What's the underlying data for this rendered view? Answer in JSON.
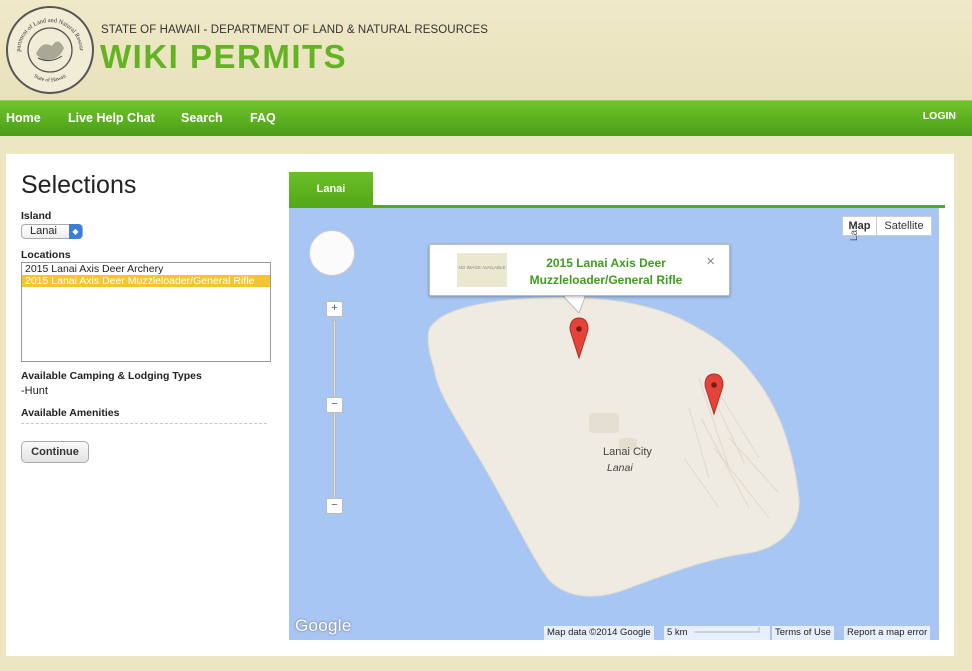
{
  "header": {
    "seal_text": [
      "Department of Land and Natural Resources",
      "State of Hawaii"
    ],
    "department": "STATE OF HAWAII - DEPARTMENT OF LAND & NATURAL RESOURCES",
    "brand": "WIKI PERMITS"
  },
  "nav": {
    "items": [
      "Home",
      "Live Help Chat",
      "Search",
      "FAQ"
    ],
    "login": "LOGIN"
  },
  "selections": {
    "title": "Selections",
    "island_label": "Island",
    "island_value": "Lanai",
    "locations_label": "Locations",
    "locations": [
      "2015 Lanai Axis Deer Archery",
      "2015 Lanai Axis Deer Muzzleloader/General Rifle"
    ],
    "selected_location_index": 1,
    "camping_label": "Available Camping & Lodging Types",
    "camping_value": "-Hunt",
    "amenities_label": "Available Amenities",
    "continue_label": "Continue"
  },
  "map": {
    "tab_label": "Lanai",
    "map_btn": "Map",
    "satellite_btn": "Satellite",
    "info_title_line1": "2015 Lanai Axis Deer",
    "info_title_line2": "Muzzleloader/General Rifle",
    "no_image": "NO IMAGE AVAILABLE",
    "close": "×",
    "city": "Lanai City",
    "island_label": "Lanai",
    "edge_label": "La",
    "google": "Google",
    "map_data": "Map data ©2014 Google",
    "scale": "5 km",
    "terms": "Terms of Use",
    "report": "Report a map error",
    "zoom_in": "+",
    "zoom_out": "−",
    "colors": {
      "water": "#a8c6f4",
      "land": "#efebe2",
      "pin": "#e4433a"
    }
  }
}
